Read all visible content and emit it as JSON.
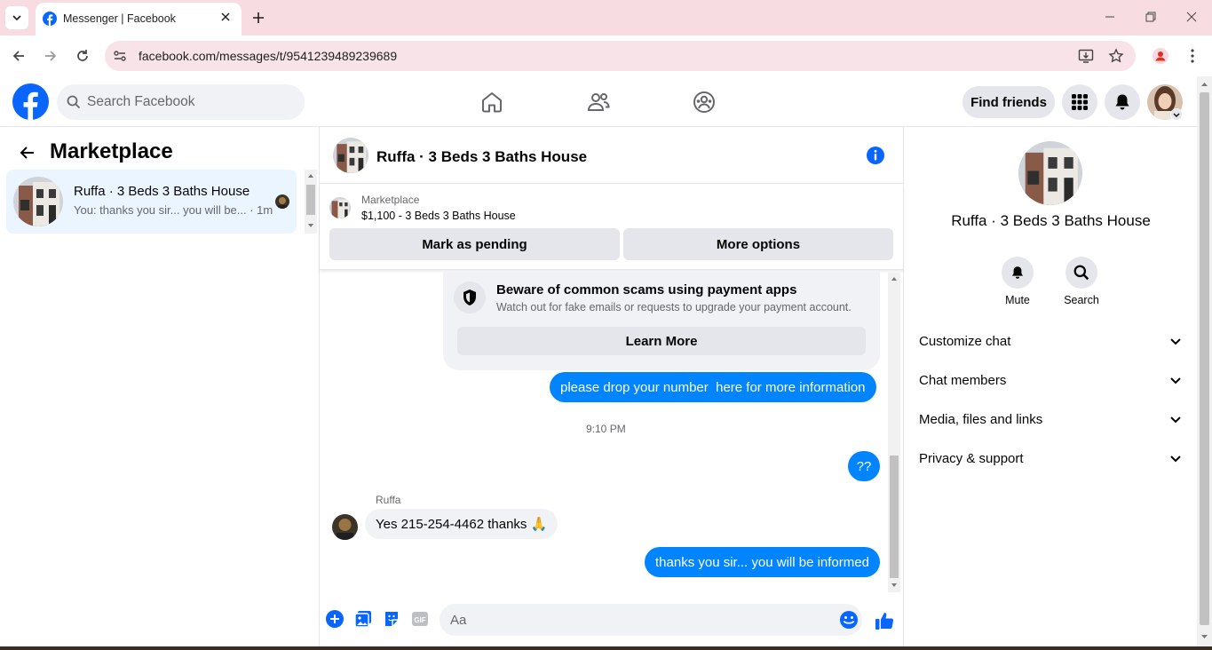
{
  "browser": {
    "tab_title": "Messenger | Facebook",
    "url": "facebook.com/messages/t/9541239489239689"
  },
  "fb_header": {
    "search_placeholder": "Search Facebook",
    "find_friends_label": "Find friends"
  },
  "left_panel": {
    "title": "Marketplace",
    "conversations": [
      {
        "name": "Ruffa · 3 Beds 3 Baths House",
        "snippet": "You: thanks you sir... you will be... · 1m"
      }
    ]
  },
  "chat": {
    "header_name": "Ruffa · 3 Beds 3 Baths House",
    "listing": {
      "category": "Marketplace",
      "price_title": "$1,100 - 3 Beds 3 Baths House",
      "mark_pending_label": "Mark as pending",
      "more_options_label": "More options"
    },
    "scam_notice": {
      "title": "Beware of common scams using payment apps",
      "subtitle": "Watch out for fake emails or requests to upgrade your payment account.",
      "button_label": "Learn More"
    },
    "messages": [
      {
        "from": "me",
        "text": "please drop your number  here for more information"
      },
      {
        "type": "timestamp",
        "text": "9:10 PM"
      },
      {
        "from": "me",
        "text": "??"
      },
      {
        "from": "Ruffa",
        "sender_label": "Ruffa",
        "text": "Yes 215-254-4462 thanks 🙏"
      },
      {
        "from": "me",
        "text": "thanks you sir... you will be informed"
      }
    ],
    "composer_placeholder": "Aa",
    "gif_label": "GIF"
  },
  "right_panel": {
    "name": "Ruffa · 3 Beds 3 Baths House",
    "actions": [
      {
        "label": "Mute",
        "icon": "bell-icon"
      },
      {
        "label": "Search",
        "icon": "search-icon"
      }
    ],
    "sections": [
      "Customize chat",
      "Chat members",
      "Media, files and links",
      "Privacy & support"
    ]
  },
  "colors": {
    "messenger_blue": "#0084ff",
    "facebook_blue": "#0866ff",
    "tab_strip": "#f7dde2"
  }
}
